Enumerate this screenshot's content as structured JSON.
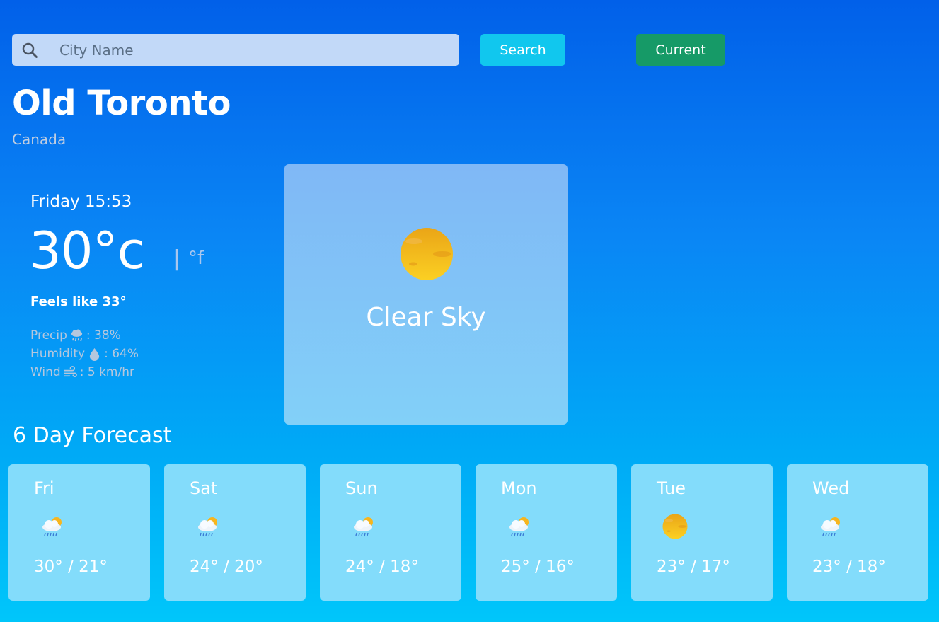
{
  "search": {
    "placeholder": "City Name",
    "value": "",
    "button_label": "Search"
  },
  "current_button_label": "Current",
  "location": {
    "city": "Old Toronto",
    "country": "Canada"
  },
  "current": {
    "datetime": "Friday 15:53",
    "temperature": "30°c",
    "unit_separator": "|",
    "alt_unit": "°f",
    "feels_like": "Feels like 33°",
    "precip_label": "Precip",
    "precip_value": ": 38%",
    "humidity_label": "Humidity",
    "humidity_value": ": 64%",
    "wind_label": "Wind",
    "wind_value": ": 5 km/hr",
    "condition": "Clear Sky",
    "condition_icon": "sun-icon"
  },
  "forecast_title": "6 Day Forecast",
  "forecast": [
    {
      "day": "Fri",
      "temps": "30° / 21°",
      "icon": "rain-cloud-sun-icon"
    },
    {
      "day": "Sat",
      "temps": "24° / 20°",
      "icon": "rain-cloud-sun-icon"
    },
    {
      "day": "Sun",
      "temps": "24° / 18°",
      "icon": "rain-cloud-sun-icon"
    },
    {
      "day": "Mon",
      "temps": "25° / 16°",
      "icon": "rain-cloud-sun-icon"
    },
    {
      "day": "Tue",
      "temps": "23° / 17°",
      "icon": "sun-icon"
    },
    {
      "day": "Wed",
      "temps": "23° / 18°",
      "icon": "rain-cloud-sun-icon"
    }
  ],
  "colors": {
    "search_button": "#11c7ee",
    "current_button": "#169a67",
    "sun": "#f5b81c",
    "card": "#83dcfb"
  }
}
